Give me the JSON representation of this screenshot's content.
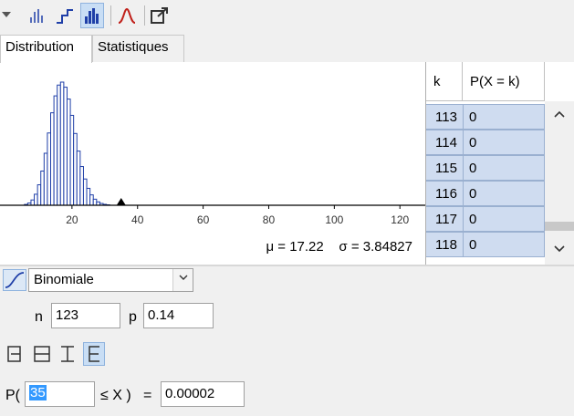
{
  "toolbar": {
    "buttons": [
      {
        "name": "bar-chart-icon",
        "active": false
      },
      {
        "name": "step-function-icon",
        "active": false
      },
      {
        "name": "histogram-icon",
        "active": true
      },
      {
        "name": "normal-overlay-icon",
        "active": false
      },
      {
        "name": "export-icon",
        "active": false
      }
    ]
  },
  "tabs": {
    "distribution": "Distribution",
    "statistics": "Statistiques"
  },
  "plot": {
    "mu_text": "μ = 17.22",
    "sigma_text": "σ = 3.84827",
    "marker_x": 35
  },
  "chart_data": {
    "type": "bar",
    "x_ticks": [
      "20",
      "40",
      "60",
      "80",
      "100",
      "120"
    ],
    "xlim": [
      0,
      123
    ],
    "n": 123,
    "p": 0.14
  },
  "table": {
    "col_k": "k",
    "col_p": "P(X = k)",
    "rows": [
      {
        "k": "113",
        "p": "0"
      },
      {
        "k": "114",
        "p": "0"
      },
      {
        "k": "115",
        "p": "0"
      },
      {
        "k": "116",
        "p": "0"
      },
      {
        "k": "117",
        "p": "0"
      },
      {
        "k": "118",
        "p": "0"
      }
    ]
  },
  "distribution": {
    "selected": "Binomiale"
  },
  "params": {
    "n_label": "n",
    "n_value": "123",
    "p_label": "p",
    "p_value": "0.14"
  },
  "probability": {
    "prefix": "P(",
    "lower_value": "35",
    "operator": "≤ X )",
    "equals": "=",
    "result": "0.00002"
  },
  "colors": {
    "bar_stroke": "#1f3fa8",
    "selection": "#c9def5",
    "table_cell": "#cfdcf0"
  }
}
